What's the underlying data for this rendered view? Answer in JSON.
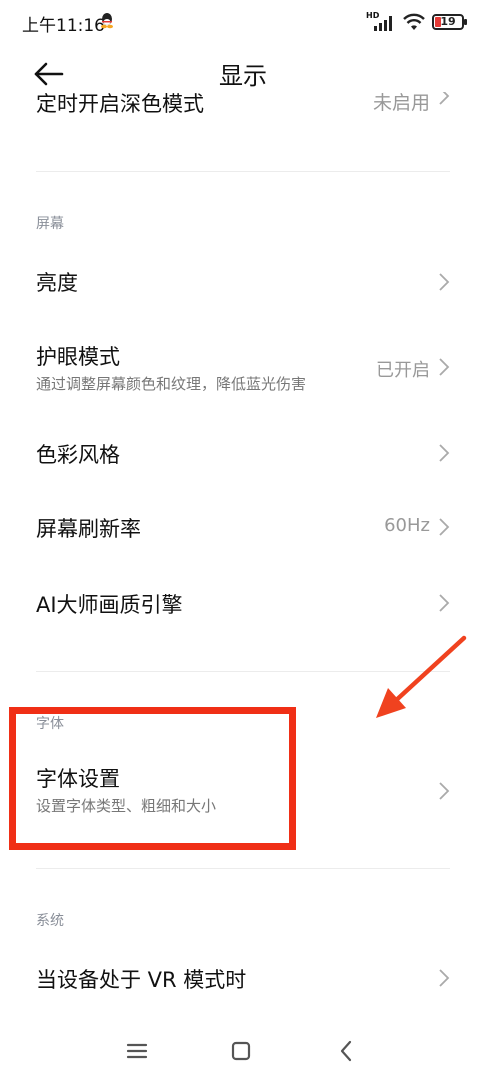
{
  "status_bar": {
    "time": "上午11:16",
    "network_badge": "HD",
    "battery_level": "19",
    "icons": [
      "qq-icon",
      "signal-icon",
      "wifi-icon",
      "battery-icon"
    ]
  },
  "header": {
    "back_icon": "back-arrow-icon",
    "title": "显示"
  },
  "clipped_item": {
    "label": "定时开启深色模式",
    "value": "未启用"
  },
  "sections": {
    "screen": {
      "header": "屏幕",
      "items": [
        {
          "label": "亮度",
          "subtitle": "",
          "value": ""
        },
        {
          "label": "护眼模式",
          "subtitle": "通过调整屏幕颜色和纹理，降低蓝光伤害",
          "value": "已开启"
        },
        {
          "label": "色彩风格",
          "subtitle": "",
          "value": ""
        },
        {
          "label": "屏幕刷新率",
          "subtitle": "",
          "value": "60Hz"
        },
        {
          "label": "AI大师画质引擎",
          "subtitle": "",
          "value": ""
        }
      ]
    },
    "font": {
      "header": "字体",
      "items": [
        {
          "label": "字体设置",
          "subtitle": "设置字体类型、粗细和大小",
          "value": ""
        }
      ]
    },
    "system": {
      "header": "系统",
      "items": [
        {
          "label": "当设备处于 VR 模式时",
          "subtitle": "",
          "value": ""
        }
      ]
    }
  },
  "annotation": {
    "highlight_color": "#f02f16",
    "arrow_color": "#f0421f"
  },
  "nav_bar": {
    "icons": [
      "menu-icon",
      "home-icon",
      "back-icon"
    ]
  }
}
